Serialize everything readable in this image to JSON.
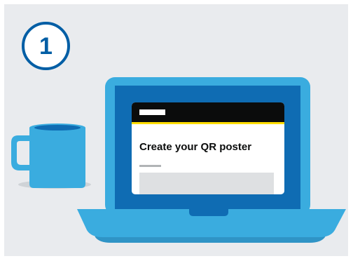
{
  "step": {
    "number": "1"
  },
  "screen": {
    "title": "Create your QR poster"
  },
  "colors": {
    "background": "#e9ebee",
    "badge_border": "#005ea5",
    "laptop_frame": "#3aacdf",
    "laptop_screen": "#0f6cb3",
    "mug": "#3aacdf",
    "header": "#0b0c0c",
    "stripe": "#ffdd00",
    "placeholder": "#dee0e2"
  },
  "icons": {
    "mug": "mug-icon",
    "laptop": "laptop-icon"
  }
}
